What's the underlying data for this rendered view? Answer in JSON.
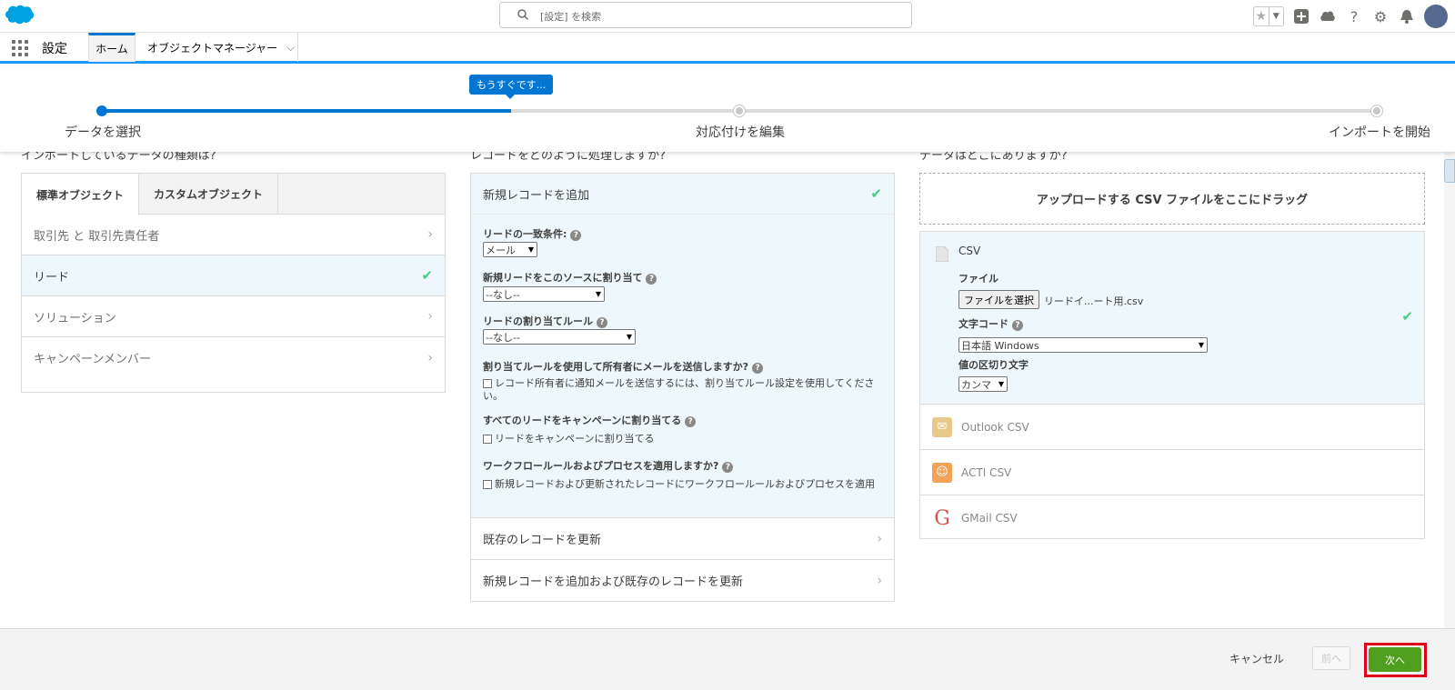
{
  "header": {
    "search_placeholder": "[設定] を検索"
  },
  "nav": {
    "app_name": "設定",
    "tab_home": "ホーム",
    "tab_object_manager": "オブジェクトマネージャー"
  },
  "progress": {
    "tooltip": "もうすぐです...",
    "steps": [
      "データを選択",
      "対応付けを編集",
      "インポートを開始"
    ],
    "current_step": 1
  },
  "columns": {
    "left_heading": "インポートしているデータの種類は?",
    "mid_heading": "レコードをどのように処理しますか?",
    "right_heading": "データはどこにありますか?"
  },
  "left": {
    "tabs": [
      "標準オブジェクト",
      "カスタムオブジェクト"
    ],
    "items": [
      "取引先 と 取引先責任者",
      "リード",
      "ソリューション",
      "キャンペーンメンバー"
    ]
  },
  "mid": {
    "selected": "新規レコードを追加",
    "match_label": "リードの一致条件:",
    "match_value": "メール",
    "source_label": "新規リードをこのソースに割り当て",
    "source_value": "--なし--",
    "rule_label": "リードの割り当てルール",
    "rule_value": "--なし--",
    "email_label": "割り当てルールを使用して所有者にメールを送信しますか?",
    "email_cb_line1": "レコード所有者に通知メールを送信するには、割り当てルール設定を使用してくださ",
    "email_cb_line2": "い。",
    "campaign_label": "すべてのリードをキャンペーンに割り当てる",
    "campaign_cb": "リードをキャンペーンに割り当てる",
    "workflow_label": "ワークフロールールおよびプロセスを適用しますか?",
    "workflow_cb": "新規レコードおよび更新されたレコードにワークフロールールおよびプロセスを適用",
    "update": "既存のレコードを更新",
    "add_update": "新規レコードを追加および既存のレコードを更新"
  },
  "right": {
    "drop": "アップロードする CSV ファイルをここにドラッグ",
    "csv": "CSV",
    "file_label": "ファイル",
    "file_button": "ファイルを選択",
    "file_name": "リードイ...ート用.csv",
    "encoding_label": "文字コード",
    "encoding_value": "日本語 Windows",
    "delimiter_label": "値の区切り文字",
    "delimiter_value": "カンマ",
    "sources": [
      "Outlook CSV",
      "ACTI CSV",
      "GMail CSV"
    ]
  },
  "footer": {
    "cancel": "キャンセル",
    "prev": "前へ",
    "next": "次へ"
  },
  "colors": {
    "brand": "#0176d3",
    "next_button": "#4f9e1e",
    "highlight": "#e0001b",
    "selected_bg": "#eef8fc"
  }
}
